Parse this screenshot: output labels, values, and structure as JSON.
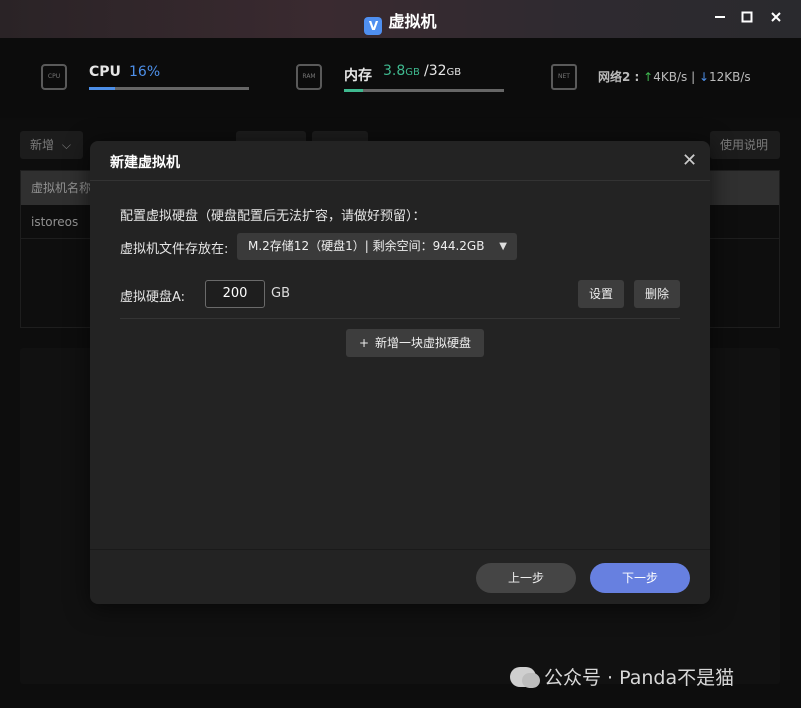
{
  "titlebar": {
    "title": "虚拟机",
    "logo_glyph": "V"
  },
  "stats": {
    "cpu": {
      "label": "CPU",
      "value": "16%",
      "progress": 0.16,
      "icon": "cpu-chip-icon",
      "chip_text": "CPU"
    },
    "ram": {
      "label": "内存",
      "used": "3.8",
      "used_unit": "GB",
      "sep": "/",
      "total": "32",
      "total_unit": "GB",
      "progress": 0.12,
      "icon": "ram-chip-icon",
      "chip_text": "RAM"
    },
    "net": {
      "label": "网络2 :",
      "up": "4KB/s",
      "sep": "|",
      "down": "12KB/s",
      "icon": "network-icon",
      "chip_text": "NET"
    }
  },
  "toolbar": {
    "new_label": "新增",
    "help_label": "使用说明"
  },
  "table": {
    "header": "虚拟机名称",
    "rows": [
      "istoreos"
    ]
  },
  "modal": {
    "title": "新建虚拟机",
    "section_title": "配置虚拟硬盘（硬盘配置后无法扩容，请做好预留）：",
    "location_label": "虚拟机文件存放在:",
    "location_value": "M.2存储12（硬盘1）| 剩余空间：944.2GB",
    "disk_label": "虚拟硬盘A:",
    "disk_size": "200",
    "disk_unit": "GB",
    "settings_label": "设置",
    "delete_label": "删除",
    "add_disk_label": "新增一块虚拟硬盘",
    "prev_label": "上一步",
    "next_label": "下一步"
  },
  "watermark": {
    "text": "公众号 · Panda不是猫"
  },
  "colors": {
    "accent": "#4d8fe8",
    "ram_accent": "#3fb98f",
    "primary_button": "#6780e0",
    "up_arrow": "#3fb950",
    "down_arrow": "#4d8fe8"
  }
}
